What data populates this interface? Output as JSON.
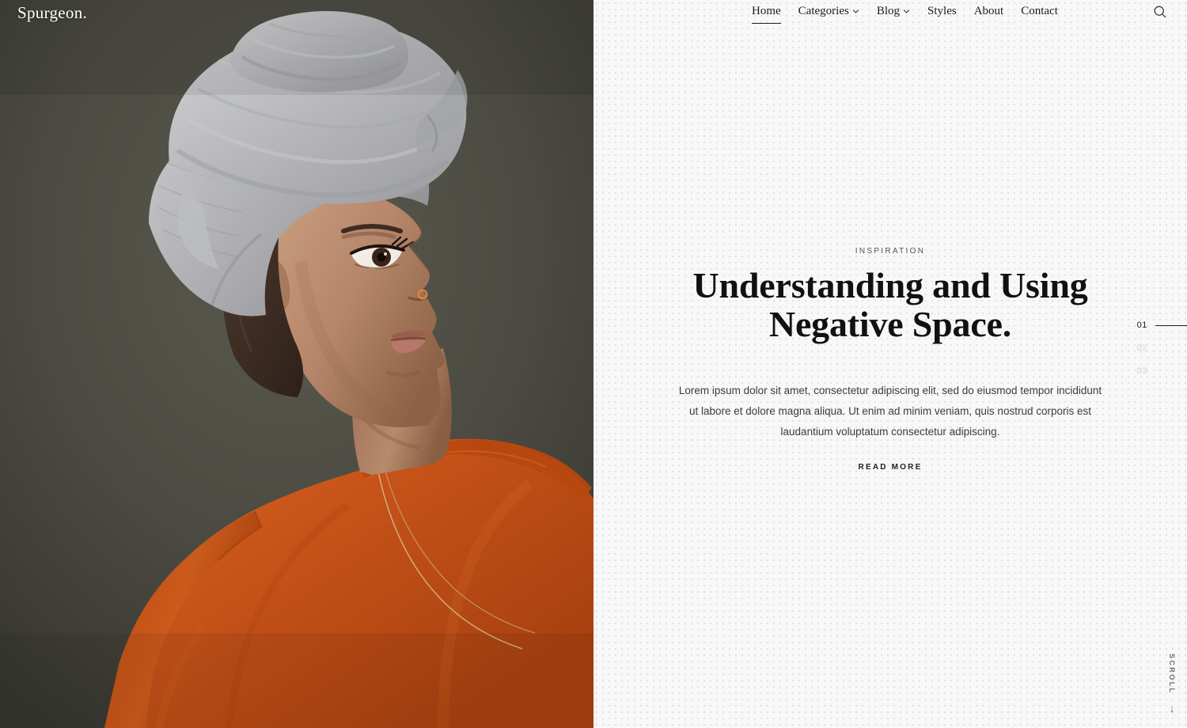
{
  "brand": {
    "logo": "Spurgeon."
  },
  "nav": {
    "items": [
      {
        "label": "Home",
        "icon": null,
        "active": true
      },
      {
        "label": "Categories",
        "icon": "chevron-down-icon",
        "active": false
      },
      {
        "label": "Blog",
        "icon": "chevron-down-icon",
        "active": false
      },
      {
        "label": "Styles",
        "icon": null,
        "active": false
      },
      {
        "label": "About",
        "icon": null,
        "active": false
      },
      {
        "label": "Contact",
        "icon": null,
        "active": false
      }
    ],
    "search_icon": "search-icon"
  },
  "hero_slide": {
    "eyebrow": "INSPIRATION",
    "headline": "Understanding and Using Negative Space.",
    "body": "Lorem ipsum dolor sit amet, consectetur adipiscing elit, sed do eiusmod tempor incididunt ut labore et dolore magna aliqua. Ut enim ad minim veniam, quis nostrud corporis est laudantium voluptatum consectetur adipiscing.",
    "cta": "READ MORE"
  },
  "pager": {
    "items": [
      {
        "label": "01",
        "active": true
      },
      {
        "label": "02",
        "active": false
      },
      {
        "label": "03",
        "active": false
      }
    ]
  },
  "scroll": {
    "label": "SCROLL",
    "arrow": "↓"
  },
  "colors": {
    "panel_bg": "#f8f8f9",
    "dot": "#dedee4",
    "photo_bg_olive": "#474740",
    "garment_orange": "#c8541a",
    "headwrap_gray": "#b8b9bb",
    "text_dark": "#111111",
    "pager_inactive": "#d3d3d9"
  }
}
